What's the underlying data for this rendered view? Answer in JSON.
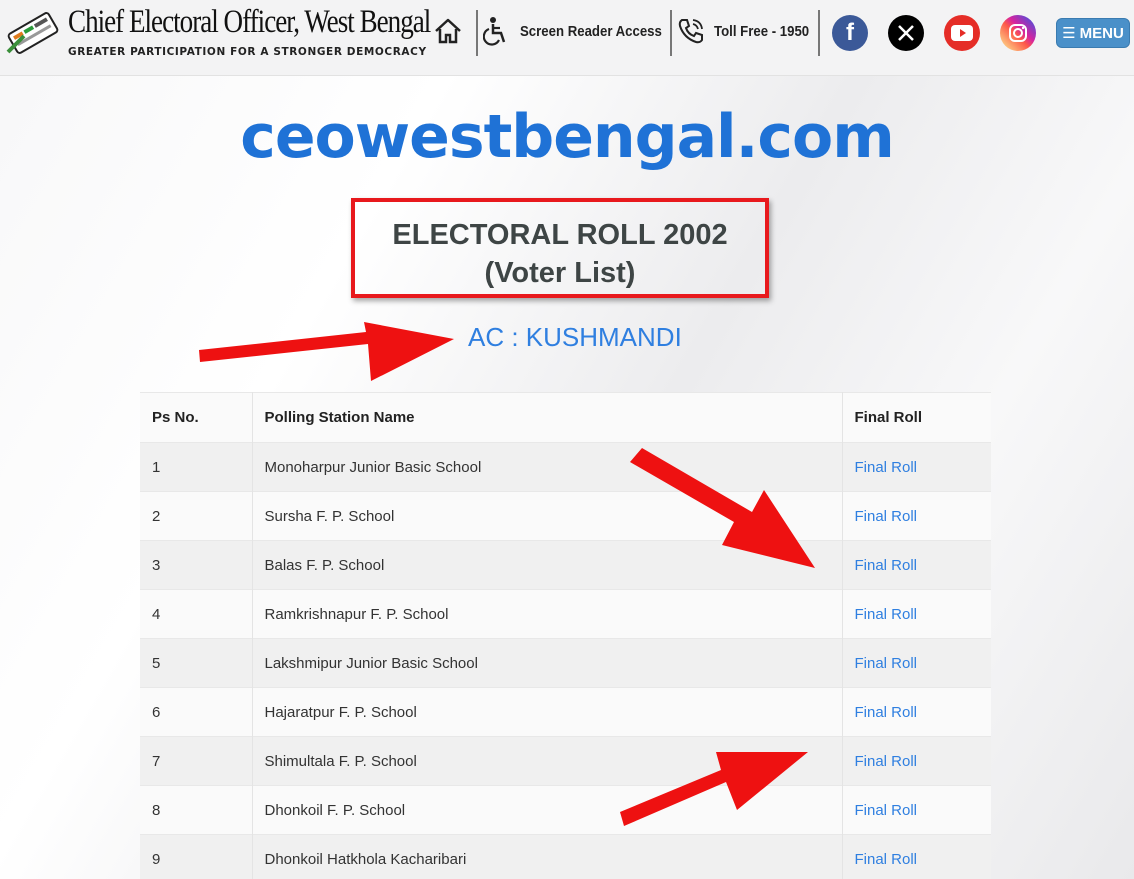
{
  "header": {
    "title": "Chief Electoral Officer, West Bengal",
    "tagline": "GREATER PARTICIPATION FOR A STRONGER DEMOCRACY",
    "screen_reader": "Screen Reader Access",
    "toll_free": "Toll Free - 1950",
    "menu_label": "MENU",
    "social": [
      {
        "icon": "facebook-icon",
        "glyph": "f",
        "color": "#3b5998"
      },
      {
        "icon": "x-icon",
        "glyph": "𝕏",
        "color": "#000000"
      },
      {
        "icon": "youtube-icon",
        "glyph": "▶",
        "color": "#e52d27"
      },
      {
        "icon": "instagram-icon",
        "glyph": "◎",
        "color": "#d6249f"
      }
    ]
  },
  "main": {
    "site_name": "ceowestbengal.com",
    "roll_title_line1": "ELECTORAL ROLL 2002",
    "roll_title_line2": "(Voter List)",
    "ac_label": "AC : KUSHMANDI"
  },
  "table": {
    "headers": [
      "Ps No.",
      "Polling Station Name",
      "Final Roll"
    ],
    "rows": [
      {
        "no": "1",
        "name": "Monoharpur Junior Basic School",
        "link": "Final Roll"
      },
      {
        "no": "2",
        "name": "Sursha F. P. School",
        "link": "Final Roll"
      },
      {
        "no": "3",
        "name": "Balas F. P. School",
        "link": "Final Roll"
      },
      {
        "no": "4",
        "name": "Ramkrishnapur F. P. School",
        "link": "Final Roll"
      },
      {
        "no": "5",
        "name": "Lakshmipur Junior Basic School",
        "link": "Final Roll"
      },
      {
        "no": "6",
        "name": "Hajaratpur F. P. School",
        "link": "Final Roll"
      },
      {
        "no": "7",
        "name": "Shimultala F. P. School",
        "link": "Final Roll"
      },
      {
        "no": "8",
        "name": "Dhonkoil F. P. School",
        "link": "Final Roll"
      },
      {
        "no": "9",
        "name": "Dhonkoil Hatkhola Kacharibari",
        "link": "Final Roll"
      }
    ]
  },
  "colors": {
    "accent": "#1f72d6",
    "link": "#2f7fe0",
    "annotation": "#e8191d"
  }
}
